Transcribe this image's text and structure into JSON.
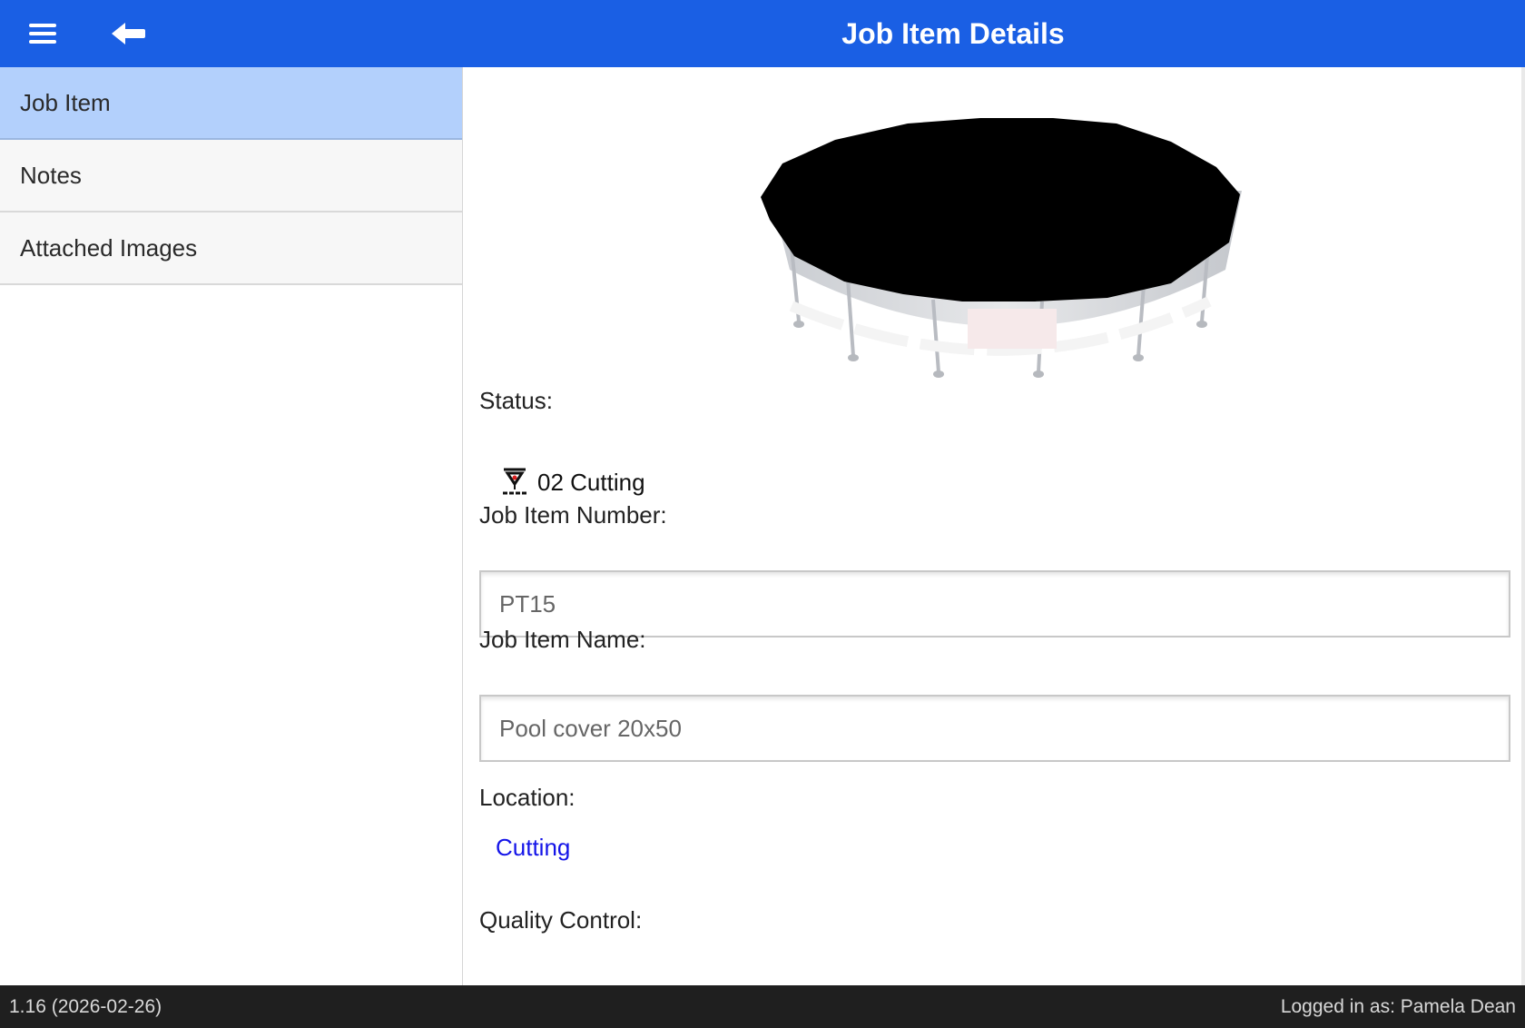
{
  "header": {
    "title": "Job Item Details",
    "menu_icon": "hamburger-menu-icon",
    "back_icon": "arrow-left-icon",
    "color": "#1a5fe4"
  },
  "sidebar": {
    "items": [
      {
        "label": "Job Item",
        "active": true
      },
      {
        "label": "Notes",
        "active": false
      },
      {
        "label": "Attached Images",
        "active": false
      }
    ],
    "active_color": "#b3d0fc"
  },
  "main": {
    "image": "pool-cover-image",
    "status_label": "Status:",
    "status_value": "02 Cutting",
    "status_icon": "cutting-station-icon",
    "number_label": "Job Item Number:",
    "number_value": "PT15",
    "name_label": "Job Item Name:",
    "name_value": "Pool cover 20x50",
    "location_label": "Location:",
    "location_value": "Cutting",
    "qc_label": "Quality Control:",
    "link_color": "#1414e8"
  },
  "footer": {
    "version": "1.16 (2026-02-26)",
    "user": "Logged in as: Pamela Dean"
  }
}
